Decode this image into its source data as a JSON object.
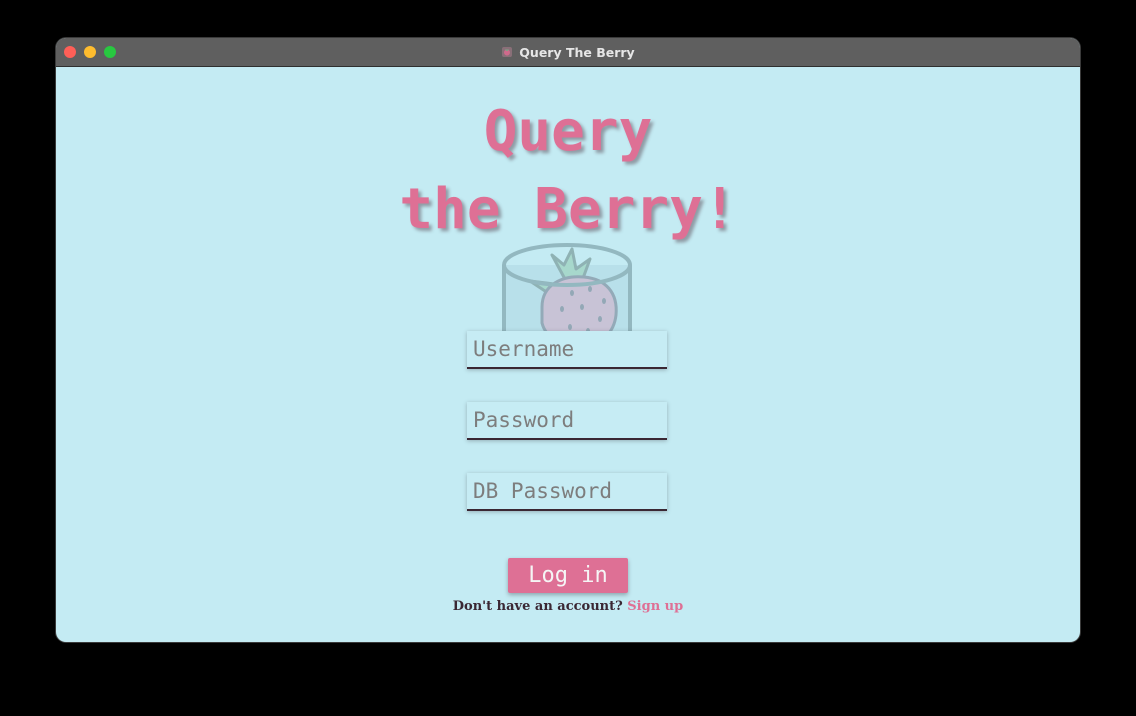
{
  "window": {
    "title": "Query The Berry",
    "title_icon": "strawberry-jar-icon"
  },
  "app": {
    "title_line1": "Query",
    "title_line2": "the Berry!",
    "logo_icon": "strawberry-in-database-icon"
  },
  "form": {
    "username_placeholder": "Username",
    "username_value": "",
    "password_placeholder": "Password",
    "password_value": "",
    "db_password_placeholder": "DB Password",
    "db_password_value": "",
    "login_label": "Log in",
    "signup_prompt": "Don't have an account?",
    "signup_link": "Sign up"
  },
  "colors": {
    "background": "#c4ebf3",
    "accent": "#de7095",
    "text_dark": "#3a2733",
    "titlebar": "#5f5f5f"
  }
}
